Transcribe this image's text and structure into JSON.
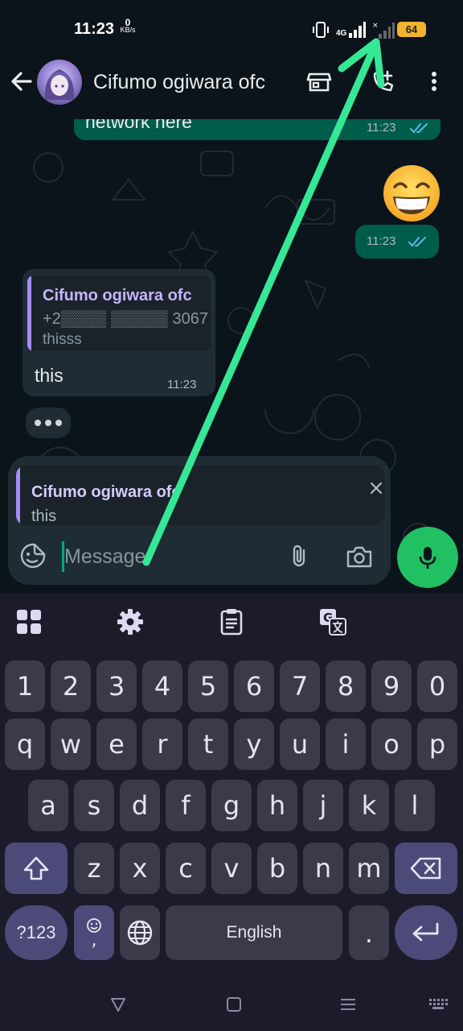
{
  "status": {
    "time": "11:23",
    "speed_value": "0",
    "speed_unit": "KB/s",
    "network": "4G",
    "battery": "64"
  },
  "header": {
    "contact_name": "Cifumo ogiwara ofc"
  },
  "messages": {
    "out1_text": "network here",
    "out1_time": "11:23",
    "out2_emoji": "😁",
    "out2_time": "11:23",
    "in1_quote_name": "Cifumo ogiwara ofc",
    "in1_quote_number": "+2▒▒▒▒ ▒▒▒▒▒ 3067",
    "in1_quote_text": "thisss",
    "in1_text": "this",
    "in1_time": "11:23"
  },
  "composer": {
    "reply_name": "Cifumo ogiwara ofc",
    "reply_text": "this",
    "placeholder": "Message"
  },
  "keyboard": {
    "rows": [
      [
        "1",
        "2",
        "3",
        "4",
        "5",
        "6",
        "7",
        "8",
        "9",
        "0"
      ],
      [
        "q",
        "w",
        "e",
        "r",
        "t",
        "y",
        "u",
        "i",
        "o",
        "p"
      ],
      [
        "a",
        "s",
        "d",
        "f",
        "g",
        "h",
        "j",
        "k",
        "l"
      ],
      [
        "z",
        "x",
        "c",
        "v",
        "b",
        "n",
        "m"
      ]
    ],
    "symbols_key": "?123",
    "emoji_key_sub": ",",
    "space_label": "English",
    "period_key": "."
  },
  "colors": {
    "outgoing_bubble": "#005c4b",
    "incoming_bubble": "#202c33",
    "accent_green": "#21c063",
    "quote_purple": "#a58cff",
    "annotation_arrow": "#34e896"
  }
}
